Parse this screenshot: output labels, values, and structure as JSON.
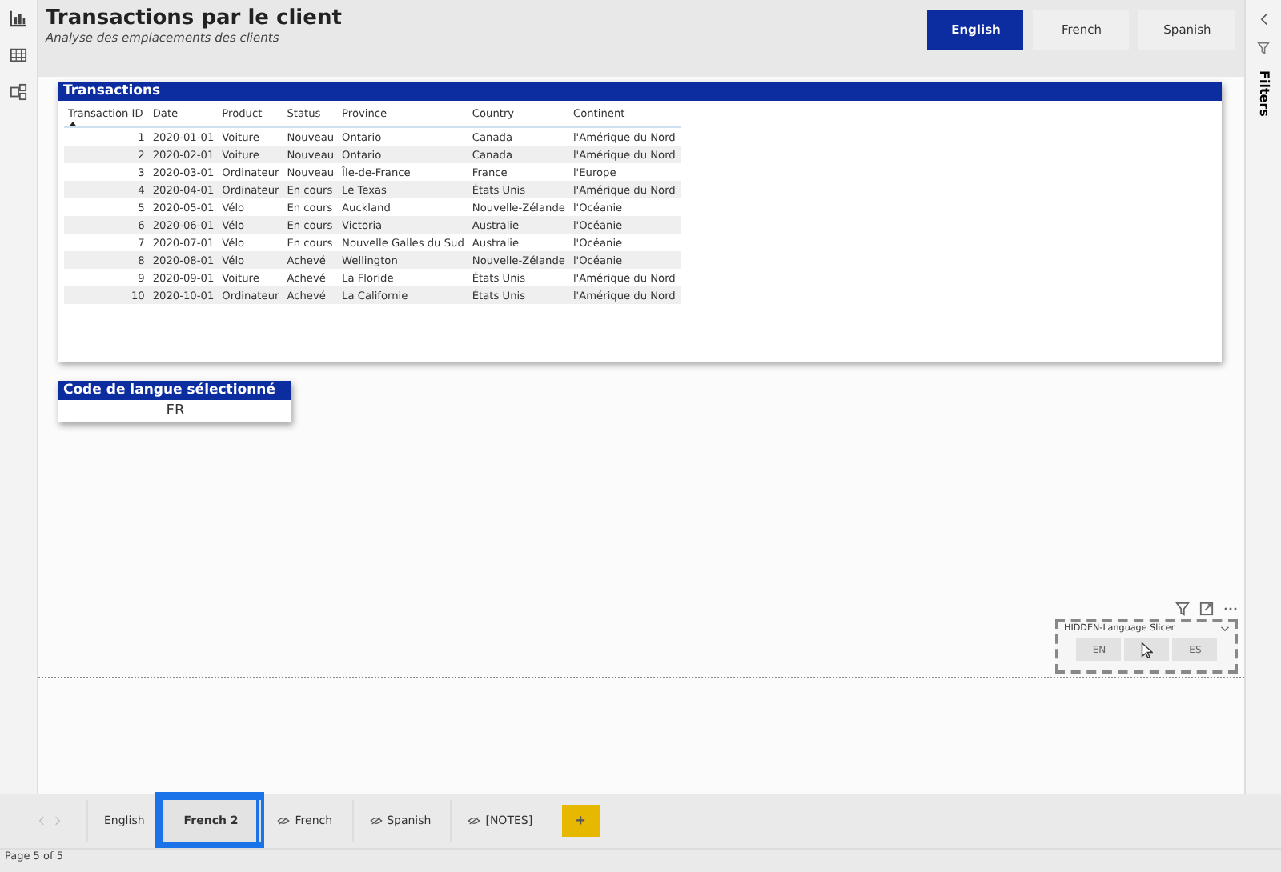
{
  "report": {
    "title": "Transactions par le client",
    "subtitle": "Analyse des emplacements des clients"
  },
  "language_buttons": [
    {
      "label": "English",
      "selected": true
    },
    {
      "label": "French",
      "selected": false
    },
    {
      "label": "Spanish",
      "selected": false
    }
  ],
  "filters_pane": {
    "label": "Filters"
  },
  "table": {
    "title": "Transactions",
    "columns": [
      {
        "label": "Transaction ID",
        "sorted": true
      },
      {
        "label": "Date",
        "sorted": false
      },
      {
        "label": "Product",
        "sorted": false
      },
      {
        "label": "Status",
        "sorted": false
      },
      {
        "label": "Province",
        "sorted": false
      },
      {
        "label": "Country",
        "sorted": false
      },
      {
        "label": "Continent",
        "sorted": false
      }
    ],
    "rows": [
      [
        "1",
        "2020-01-01",
        "Voiture",
        "Nouveau",
        "Ontario",
        "Canada",
        "l'Amérique du Nord"
      ],
      [
        "2",
        "2020-02-01",
        "Voiture",
        "Nouveau",
        "Ontario",
        "Canada",
        "l'Amérique du Nord"
      ],
      [
        "3",
        "2020-03-01",
        "Ordinateur",
        "Nouveau",
        "Île-de-France",
        "France",
        "l'Europe"
      ],
      [
        "4",
        "2020-04-01",
        "Ordinateur",
        "En cours",
        "Le Texas",
        "États Unis",
        "l'Amérique du Nord"
      ],
      [
        "5",
        "2020-05-01",
        "Vélo",
        "En cours",
        "Auckland",
        "Nouvelle-Zélande",
        "l'Océanie"
      ],
      [
        "6",
        "2020-06-01",
        "Vélo",
        "En cours",
        "Victoria",
        "Australie",
        "l'Océanie"
      ],
      [
        "7",
        "2020-07-01",
        "Vélo",
        "En cours",
        "Nouvelle Galles du Sud",
        "Australie",
        "l'Océanie"
      ],
      [
        "8",
        "2020-08-01",
        "Vélo",
        "Achevé",
        "Wellington",
        "Nouvelle-Zélande",
        "l'Océanie"
      ],
      [
        "9",
        "2020-09-01",
        "Voiture",
        "Achevé",
        "La Floride",
        "États Unis",
        "l'Amérique du Nord"
      ],
      [
        "10",
        "2020-10-01",
        "Ordinateur",
        "Achevé",
        "La Californie",
        "États Unis",
        "l'Amérique du Nord"
      ]
    ]
  },
  "language_card": {
    "title": "Code de langue sélectionné",
    "value": "FR"
  },
  "slicer": {
    "title": "HIDDEN-Language Slicer",
    "items": [
      {
        "kind": "label",
        "label": "EN"
      },
      {
        "kind": "covered"
      },
      {
        "kind": "label",
        "label": "ES"
      }
    ]
  },
  "page_tabs": [
    {
      "label": "English",
      "selected": false,
      "hidden": false
    },
    {
      "label": "French 2",
      "selected": true,
      "hidden": false
    },
    {
      "label": "French",
      "selected": false,
      "hidden": true
    },
    {
      "label": "Spanish",
      "selected": false,
      "hidden": true
    },
    {
      "label": "[NOTES]",
      "selected": false,
      "hidden": true
    }
  ],
  "add_page": {
    "label": "+"
  },
  "status_bar": {
    "page": "Page 5 of 5"
  }
}
